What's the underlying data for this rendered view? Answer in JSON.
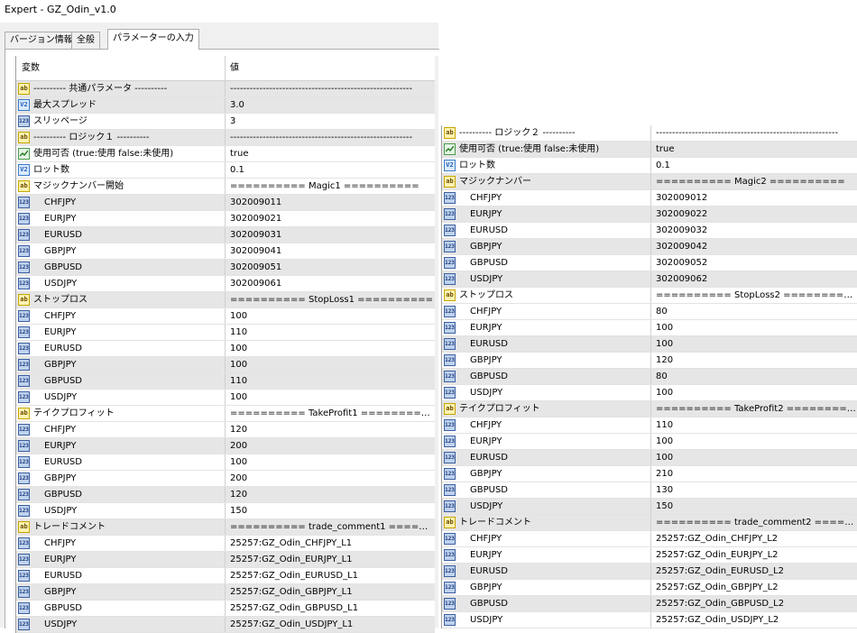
{
  "window_title": "Expert - GZ_Odin_v1.0",
  "tabs": [
    {
      "label": "バージョン情報",
      "active": false
    },
    {
      "label": "全般",
      "active": false
    },
    {
      "label": "パラメーターの入力",
      "active": true
    }
  ],
  "columns": {
    "variable": "変数",
    "value": "値"
  },
  "left_rows": [
    {
      "icon": "ab",
      "name": "---------- 共通パラメータ ----------",
      "value": "--------------------------------------------------------",
      "gray": true
    },
    {
      "icon": "v2",
      "name": "最大スプレッド",
      "value": "3.0",
      "gray": true
    },
    {
      "icon": "n123",
      "name": "スリッページ",
      "value": "3",
      "gray": false
    },
    {
      "icon": "ab",
      "name": "---------- ロジック１ ----------",
      "value": "--------------------------------------------------------",
      "gray": true
    },
    {
      "icon": "bool",
      "name": "使用可否 (true:使用 false:未使用)",
      "value": "true",
      "gray": false
    },
    {
      "icon": "v2",
      "name": "ロット数",
      "value": "0.1",
      "gray": false
    },
    {
      "icon": "ab",
      "name": "マジックナンバー開始",
      "value": "========== Magic1 ==========",
      "gray": false
    },
    {
      "icon": "n123",
      "name": "CHFJPY",
      "value": "302009011",
      "gray": true,
      "indent": true
    },
    {
      "icon": "n123",
      "name": "EURJPY",
      "value": "302009021",
      "gray": false,
      "indent": true
    },
    {
      "icon": "n123",
      "name": "EURUSD",
      "value": "302009031",
      "gray": true,
      "indent": true
    },
    {
      "icon": "n123",
      "name": "GBPJPY",
      "value": "302009041",
      "gray": false,
      "indent": true
    },
    {
      "icon": "n123",
      "name": "GBPUSD",
      "value": "302009051",
      "gray": true,
      "indent": true
    },
    {
      "icon": "n123",
      "name": "USDJPY",
      "value": "302009061",
      "gray": false,
      "indent": true
    },
    {
      "icon": "ab",
      "name": "ストップロス",
      "value": "========== StopLoss1 ==========",
      "gray": true
    },
    {
      "icon": "n123",
      "name": "CHFJPY",
      "value": "100",
      "gray": false,
      "indent": true
    },
    {
      "icon": "n123",
      "name": "EURJPY",
      "value": "110",
      "gray": false,
      "indent": true
    },
    {
      "icon": "n123",
      "name": "EURUSD",
      "value": "100",
      "gray": false,
      "indent": true
    },
    {
      "icon": "n123",
      "name": "GBPJPY",
      "value": "100",
      "gray": true,
      "indent": true
    },
    {
      "icon": "n123",
      "name": "GBPUSD",
      "value": "110",
      "gray": true,
      "indent": true
    },
    {
      "icon": "n123",
      "name": "USDJPY",
      "value": "100",
      "gray": false,
      "indent": true
    },
    {
      "icon": "ab",
      "name": "テイクプロフィット",
      "value": "========== TakeProfit1 ==========",
      "gray": false
    },
    {
      "icon": "n123",
      "name": "CHFJPY",
      "value": "120",
      "gray": false,
      "indent": true
    },
    {
      "icon": "n123",
      "name": "EURJPY",
      "value": "200",
      "gray": true,
      "indent": true
    },
    {
      "icon": "n123",
      "name": "EURUSD",
      "value": "100",
      "gray": false,
      "indent": true
    },
    {
      "icon": "n123",
      "name": "GBPJPY",
      "value": "200",
      "gray": false,
      "indent": true
    },
    {
      "icon": "n123",
      "name": "GBPUSD",
      "value": "120",
      "gray": true,
      "indent": true
    },
    {
      "icon": "n123",
      "name": "USDJPY",
      "value": "150",
      "gray": false,
      "indent": true
    },
    {
      "icon": "ab",
      "name": "トレードコメント",
      "value": "========== trade_comment1 =======...",
      "gray": true
    },
    {
      "icon": "n123",
      "name": "CHFJPY",
      "value": "25257:GZ_Odin_CHFJPY_L1",
      "gray": false,
      "indent": true
    },
    {
      "icon": "n123",
      "name": "EURJPY",
      "value": "25257:GZ_Odin_EURJPY_L1",
      "gray": true,
      "indent": true
    },
    {
      "icon": "n123",
      "name": "EURUSD",
      "value": "25257:GZ_Odin_EURUSD_L1",
      "gray": false,
      "indent": true
    },
    {
      "icon": "n123",
      "name": "GBPJPY",
      "value": "25257:GZ_Odin_GBPJPY_L1",
      "gray": true,
      "indent": true
    },
    {
      "icon": "n123",
      "name": "GBPUSD",
      "value": "25257:GZ_Odin_GBPUSD_L1",
      "gray": false,
      "indent": true
    },
    {
      "icon": "n123",
      "name": "USDJPY",
      "value": "25257:GZ_Odin_USDJPY_L1",
      "gray": true,
      "indent": true
    }
  ],
  "right_rows": [
    {
      "icon": "ab",
      "name": "---------- ロジック２ ----------",
      "value": "--------------------------------------------------------",
      "gray": false
    },
    {
      "icon": "bool",
      "name": "使用可否 (true:使用 false:未使用)",
      "value": "true",
      "gray": true
    },
    {
      "icon": "v2",
      "name": "ロット数",
      "value": "0.1",
      "gray": false
    },
    {
      "icon": "ab",
      "name": "マジックナンバー",
      "value": "========== Magic2 ==========",
      "gray": true
    },
    {
      "icon": "n123",
      "name": "CHFJPY",
      "value": "302009012",
      "gray": false,
      "indent": true
    },
    {
      "icon": "n123",
      "name": "EURJPY",
      "value": "302009022",
      "gray": true,
      "indent": true
    },
    {
      "icon": "n123",
      "name": "EURUSD",
      "value": "302009032",
      "gray": false,
      "indent": true
    },
    {
      "icon": "n123",
      "name": "GBPJPY",
      "value": "302009042",
      "gray": true,
      "indent": true
    },
    {
      "icon": "n123",
      "name": "GBPUSD",
      "value": "302009052",
      "gray": false,
      "indent": true
    },
    {
      "icon": "n123",
      "name": "USDJPY",
      "value": "302009062",
      "gray": true,
      "indent": true
    },
    {
      "icon": "ab",
      "name": "ストップロス",
      "value": "========== StopLoss2 ==========",
      "gray": false
    },
    {
      "icon": "n123",
      "name": "CHFJPY",
      "value": "80",
      "gray": false,
      "indent": true
    },
    {
      "icon": "n123",
      "name": "EURJPY",
      "value": "100",
      "gray": false,
      "indent": true
    },
    {
      "icon": "n123",
      "name": "EURUSD",
      "value": "100",
      "gray": true,
      "indent": true
    },
    {
      "icon": "n123",
      "name": "GBPJPY",
      "value": "120",
      "gray": false,
      "indent": true
    },
    {
      "icon": "n123",
      "name": "GBPUSD",
      "value": "80",
      "gray": true,
      "indent": true
    },
    {
      "icon": "n123",
      "name": "USDJPY",
      "value": "100",
      "gray": false,
      "indent": true
    },
    {
      "icon": "ab",
      "name": "テイクプロフィット",
      "value": "========== TakeProfit2 ==========",
      "gray": true
    },
    {
      "icon": "n123",
      "name": "CHFJPY",
      "value": "110",
      "gray": false,
      "indent": true
    },
    {
      "icon": "n123",
      "name": "EURJPY",
      "value": "100",
      "gray": false,
      "indent": true
    },
    {
      "icon": "n123",
      "name": "EURUSD",
      "value": "100",
      "gray": true,
      "indent": true
    },
    {
      "icon": "n123",
      "name": "GBPJPY",
      "value": "210",
      "gray": false,
      "indent": true
    },
    {
      "icon": "n123",
      "name": "GBPUSD",
      "value": "130",
      "gray": false,
      "indent": true
    },
    {
      "icon": "n123",
      "name": "USDJPY",
      "value": "150",
      "gray": true,
      "indent": true
    },
    {
      "icon": "ab",
      "name": "トレードコメント",
      "value": "========== trade_comment2 =======...",
      "gray": true
    },
    {
      "icon": "n123",
      "name": "CHFJPY",
      "value": "25257:GZ_Odin_CHFJPY_L2",
      "gray": false,
      "indent": true
    },
    {
      "icon": "n123",
      "name": "EURJPY",
      "value": "25257:GZ_Odin_EURJPY_L2",
      "gray": false,
      "indent": true
    },
    {
      "icon": "n123",
      "name": "EURUSD",
      "value": "25257:GZ_Odin_EURUSD_L2",
      "gray": true,
      "indent": true
    },
    {
      "icon": "n123",
      "name": "GBPJPY",
      "value": "25257:GZ_Odin_GBPJPY_L2",
      "gray": false,
      "indent": true
    },
    {
      "icon": "n123",
      "name": "GBPUSD",
      "value": "25257:GZ_Odin_GBPUSD_L2",
      "gray": true,
      "indent": true
    },
    {
      "icon": "n123",
      "name": "USDJPY",
      "value": "25257:GZ_Odin_USDJPY_L2",
      "gray": false,
      "indent": true
    }
  ]
}
